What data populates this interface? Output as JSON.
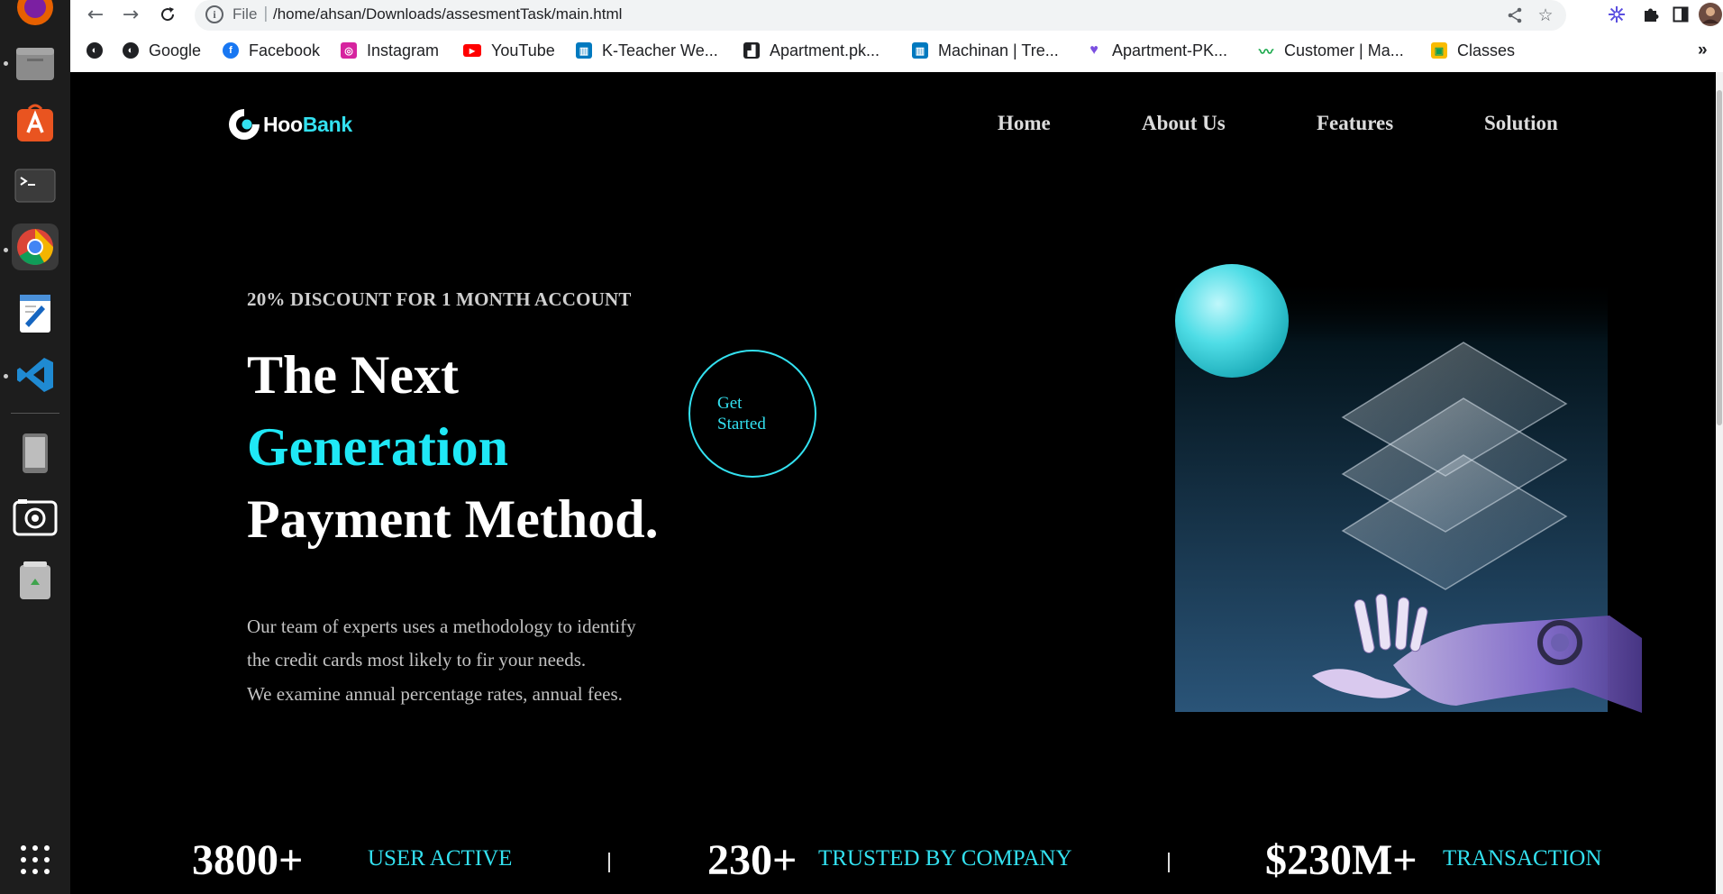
{
  "browser": {
    "url_scheme": "File",
    "url": "/home/ahsan/Downloads/assesmentTask/main.html",
    "bookmarks": [
      {
        "label": "",
        "icon": "globe-icon"
      },
      {
        "label": "Google",
        "icon": "globe-icon"
      },
      {
        "label": "Facebook",
        "icon": "facebook-icon"
      },
      {
        "label": "Instagram",
        "icon": "instagram-icon"
      },
      {
        "label": "YouTube",
        "icon": "youtube-icon"
      },
      {
        "label": "K-Teacher We...",
        "icon": "trello-icon"
      },
      {
        "label": "Apartment.pk...",
        "icon": "apartment-icon"
      },
      {
        "label": "Machinan | Tre...",
        "icon": "trello-icon"
      },
      {
        "label": "Apartment-PK...",
        "icon": "heart-icon"
      },
      {
        "label": "Customer | Ma...",
        "icon": "chart-icon"
      },
      {
        "label": "Classes",
        "icon": "classroom-icon"
      }
    ],
    "more_bookmarks": "»"
  },
  "site": {
    "logo_prefix": "Hoo",
    "logo_suffix": "Bank",
    "nav": [
      "Home",
      "About Us",
      "Features",
      "Solution"
    ],
    "discount": "20% DISCOUNT FOR 1 MONTH ACCOUNT",
    "headline": [
      "The Next",
      "Generation",
      "Payment Method."
    ],
    "cta": "Get Started",
    "description": [
      "Our team of experts uses a methodology to identify",
      "the credit cards most likely to fir your needs.",
      "We examine annual percentage rates, annual fees."
    ],
    "stats": [
      {
        "value": "3800+",
        "label": "USER ACTIVE"
      },
      {
        "value": "230+",
        "label": "TRUSTED BY COMPANY"
      },
      {
        "value": "$230M+",
        "label": "TRANSACTION"
      }
    ],
    "separator": "|"
  },
  "colors": {
    "accent": "#33e1f0",
    "background": "#000000"
  }
}
